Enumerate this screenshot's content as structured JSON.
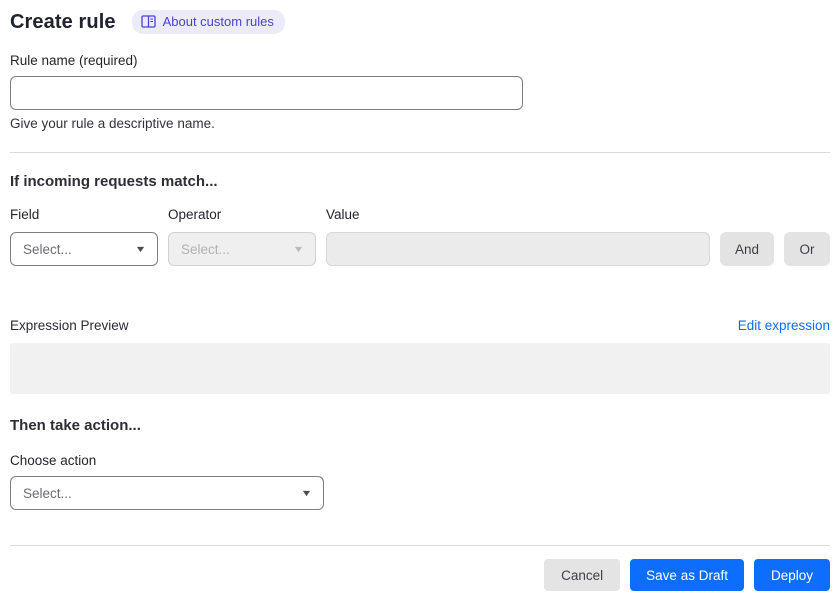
{
  "header": {
    "title": "Create rule",
    "about_badge_label": "About custom rules"
  },
  "rule_name": {
    "label": "Rule name (required)",
    "value": "",
    "helper": "Give your rule a descriptive name."
  },
  "match_section": {
    "heading": "If incoming requests match...",
    "field": {
      "label": "Field",
      "selected": "Select..."
    },
    "operator": {
      "label": "Operator",
      "selected": "Select..."
    },
    "value": {
      "label": "Value",
      "value": ""
    },
    "and_label": "And",
    "or_label": "Or",
    "expression_preview_label": "Expression Preview",
    "edit_expression_label": "Edit expression",
    "expression_value": ""
  },
  "action_section": {
    "heading": "Then take action...",
    "choose_action_label": "Choose action",
    "selected": "Select..."
  },
  "footer": {
    "cancel_label": "Cancel",
    "save_draft_label": "Save as Draft",
    "deploy_label": "Deploy"
  },
  "icons": {
    "chevron_down": "▼",
    "book_icon": "book-open-icon"
  },
  "colors": {
    "primary_blue": "#0d6efd",
    "link_blue": "#0f6bfa",
    "badge_bg": "#ecebfa",
    "badge_text": "#4a43c8",
    "heading_text": "#20222e",
    "disabled_bg": "#ebebeb",
    "neutral_button_bg": "#e4e4e4",
    "divider": "#d9d9d9",
    "preview_box_bg": "#f1f1f1"
  }
}
